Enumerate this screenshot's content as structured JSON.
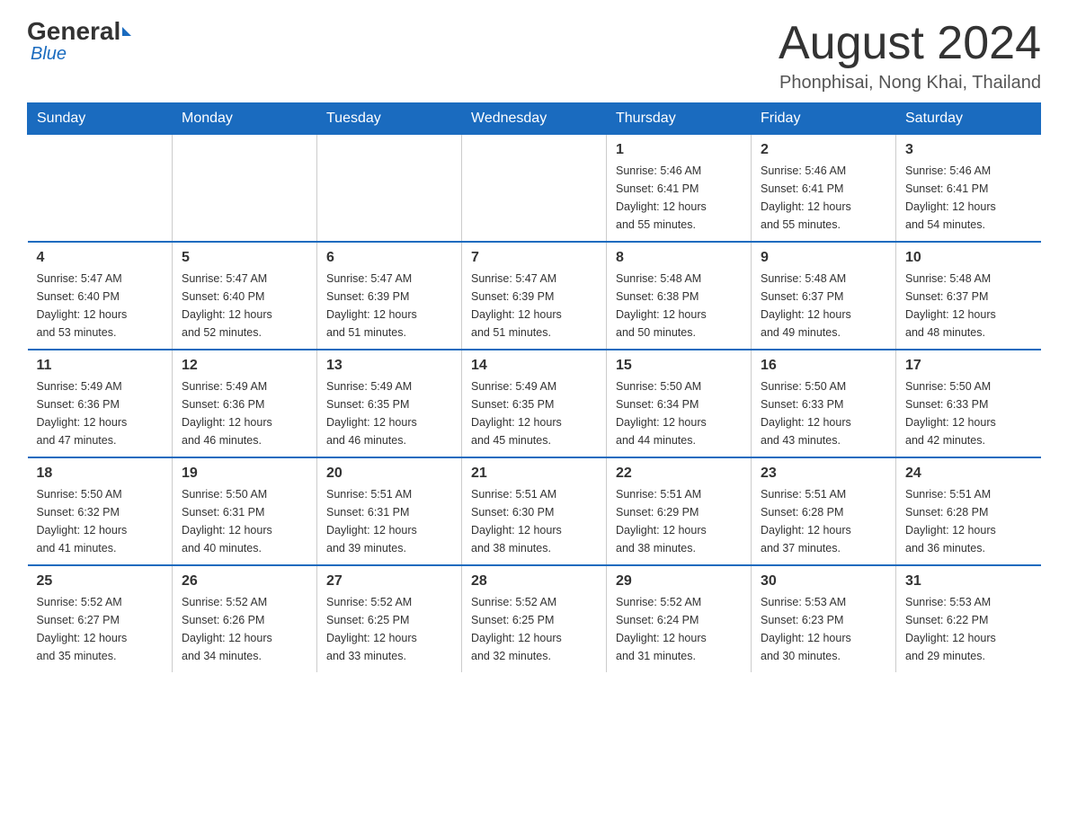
{
  "header": {
    "logo_general": "General",
    "logo_blue": "Blue",
    "month_year": "August 2024",
    "location": "Phonphisai, Nong Khai, Thailand"
  },
  "weekdays": [
    "Sunday",
    "Monday",
    "Tuesday",
    "Wednesday",
    "Thursday",
    "Friday",
    "Saturday"
  ],
  "weeks": [
    [
      {
        "day": "",
        "info": ""
      },
      {
        "day": "",
        "info": ""
      },
      {
        "day": "",
        "info": ""
      },
      {
        "day": "",
        "info": ""
      },
      {
        "day": "1",
        "info": "Sunrise: 5:46 AM\nSunset: 6:41 PM\nDaylight: 12 hours\nand 55 minutes."
      },
      {
        "day": "2",
        "info": "Sunrise: 5:46 AM\nSunset: 6:41 PM\nDaylight: 12 hours\nand 55 minutes."
      },
      {
        "day": "3",
        "info": "Sunrise: 5:46 AM\nSunset: 6:41 PM\nDaylight: 12 hours\nand 54 minutes."
      }
    ],
    [
      {
        "day": "4",
        "info": "Sunrise: 5:47 AM\nSunset: 6:40 PM\nDaylight: 12 hours\nand 53 minutes."
      },
      {
        "day": "5",
        "info": "Sunrise: 5:47 AM\nSunset: 6:40 PM\nDaylight: 12 hours\nand 52 minutes."
      },
      {
        "day": "6",
        "info": "Sunrise: 5:47 AM\nSunset: 6:39 PM\nDaylight: 12 hours\nand 51 minutes."
      },
      {
        "day": "7",
        "info": "Sunrise: 5:47 AM\nSunset: 6:39 PM\nDaylight: 12 hours\nand 51 minutes."
      },
      {
        "day": "8",
        "info": "Sunrise: 5:48 AM\nSunset: 6:38 PM\nDaylight: 12 hours\nand 50 minutes."
      },
      {
        "day": "9",
        "info": "Sunrise: 5:48 AM\nSunset: 6:37 PM\nDaylight: 12 hours\nand 49 minutes."
      },
      {
        "day": "10",
        "info": "Sunrise: 5:48 AM\nSunset: 6:37 PM\nDaylight: 12 hours\nand 48 minutes."
      }
    ],
    [
      {
        "day": "11",
        "info": "Sunrise: 5:49 AM\nSunset: 6:36 PM\nDaylight: 12 hours\nand 47 minutes."
      },
      {
        "day": "12",
        "info": "Sunrise: 5:49 AM\nSunset: 6:36 PM\nDaylight: 12 hours\nand 46 minutes."
      },
      {
        "day": "13",
        "info": "Sunrise: 5:49 AM\nSunset: 6:35 PM\nDaylight: 12 hours\nand 46 minutes."
      },
      {
        "day": "14",
        "info": "Sunrise: 5:49 AM\nSunset: 6:35 PM\nDaylight: 12 hours\nand 45 minutes."
      },
      {
        "day": "15",
        "info": "Sunrise: 5:50 AM\nSunset: 6:34 PM\nDaylight: 12 hours\nand 44 minutes."
      },
      {
        "day": "16",
        "info": "Sunrise: 5:50 AM\nSunset: 6:33 PM\nDaylight: 12 hours\nand 43 minutes."
      },
      {
        "day": "17",
        "info": "Sunrise: 5:50 AM\nSunset: 6:33 PM\nDaylight: 12 hours\nand 42 minutes."
      }
    ],
    [
      {
        "day": "18",
        "info": "Sunrise: 5:50 AM\nSunset: 6:32 PM\nDaylight: 12 hours\nand 41 minutes."
      },
      {
        "day": "19",
        "info": "Sunrise: 5:50 AM\nSunset: 6:31 PM\nDaylight: 12 hours\nand 40 minutes."
      },
      {
        "day": "20",
        "info": "Sunrise: 5:51 AM\nSunset: 6:31 PM\nDaylight: 12 hours\nand 39 minutes."
      },
      {
        "day": "21",
        "info": "Sunrise: 5:51 AM\nSunset: 6:30 PM\nDaylight: 12 hours\nand 38 minutes."
      },
      {
        "day": "22",
        "info": "Sunrise: 5:51 AM\nSunset: 6:29 PM\nDaylight: 12 hours\nand 38 minutes."
      },
      {
        "day": "23",
        "info": "Sunrise: 5:51 AM\nSunset: 6:28 PM\nDaylight: 12 hours\nand 37 minutes."
      },
      {
        "day": "24",
        "info": "Sunrise: 5:51 AM\nSunset: 6:28 PM\nDaylight: 12 hours\nand 36 minutes."
      }
    ],
    [
      {
        "day": "25",
        "info": "Sunrise: 5:52 AM\nSunset: 6:27 PM\nDaylight: 12 hours\nand 35 minutes."
      },
      {
        "day": "26",
        "info": "Sunrise: 5:52 AM\nSunset: 6:26 PM\nDaylight: 12 hours\nand 34 minutes."
      },
      {
        "day": "27",
        "info": "Sunrise: 5:52 AM\nSunset: 6:25 PM\nDaylight: 12 hours\nand 33 minutes."
      },
      {
        "day": "28",
        "info": "Sunrise: 5:52 AM\nSunset: 6:25 PM\nDaylight: 12 hours\nand 32 minutes."
      },
      {
        "day": "29",
        "info": "Sunrise: 5:52 AM\nSunset: 6:24 PM\nDaylight: 12 hours\nand 31 minutes."
      },
      {
        "day": "30",
        "info": "Sunrise: 5:53 AM\nSunset: 6:23 PM\nDaylight: 12 hours\nand 30 minutes."
      },
      {
        "day": "31",
        "info": "Sunrise: 5:53 AM\nSunset: 6:22 PM\nDaylight: 12 hours\nand 29 minutes."
      }
    ]
  ]
}
